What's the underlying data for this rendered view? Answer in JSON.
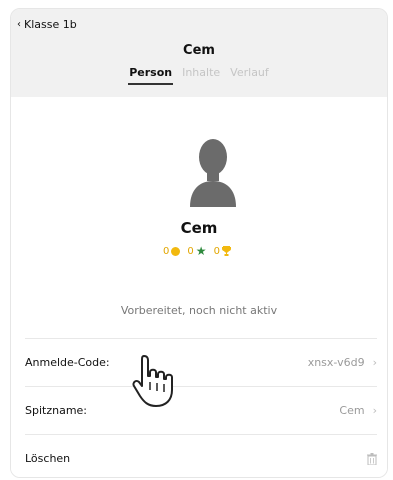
{
  "header": {
    "back_label": "Klasse 1b",
    "title": "Cem",
    "tabs": [
      {
        "label": "Person",
        "active": true
      },
      {
        "label": "Inhalte",
        "active": false
      },
      {
        "label": "Verlauf",
        "active": false
      }
    ]
  },
  "profile": {
    "name": "Cem",
    "stats": {
      "coins": "0",
      "stars": "0",
      "trophies": "0"
    },
    "status_text": "Vorbereitet, noch nicht aktiv"
  },
  "rows": [
    {
      "label": "Anmelde-Code:",
      "value": "xnsx-v6d9"
    },
    {
      "label": "Spitzname:",
      "value": "Cem"
    },
    {
      "label": "Löschen",
      "value": ""
    }
  ],
  "colors": {
    "coin": "#f2b90f",
    "star": "#2f8a3e",
    "trophy": "#f2b90f"
  }
}
